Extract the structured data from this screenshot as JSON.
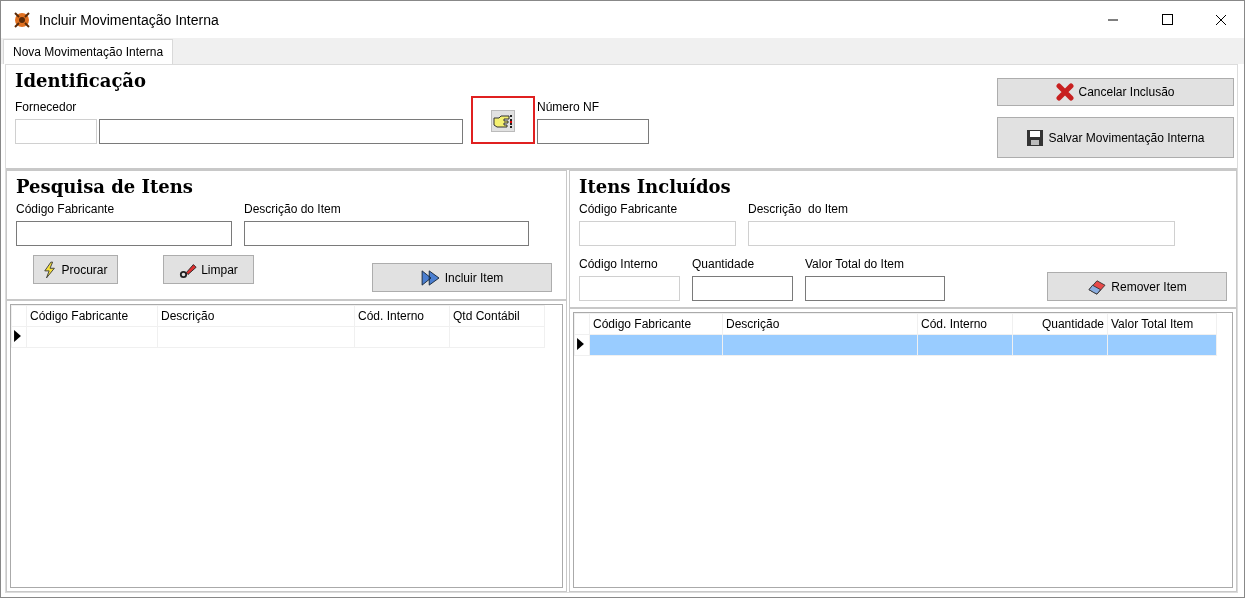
{
  "window": {
    "title": "Incluir Movimentação Interna"
  },
  "tabs": [
    {
      "label": "Nova Movimentação Interna",
      "selected": true
    }
  ],
  "identification": {
    "heading": "Identificação",
    "supplier_label": "Fornecedor",
    "supplier_code_disabled": true,
    "invoice_label": "Número NF",
    "lookup_highlighted": true,
    "buttons": [
      {
        "label": "Cancelar Inclusão",
        "kind": "cancel"
      },
      {
        "label": "Salvar Movimentação Interna",
        "kind": "save"
      }
    ]
  },
  "search": {
    "heading": "Pesquisa de Itens",
    "fields": [
      {
        "label": "Código Fabricante",
        "disabled": false
      },
      {
        "label": "Descrição do Item",
        "disabled": false
      }
    ],
    "buttons": [
      {
        "label": "Procurar",
        "kind": "search"
      },
      {
        "label": "Limpar",
        "kind": "clear"
      },
      {
        "label": "Incluir Item",
        "kind": "add"
      }
    ],
    "table": {
      "columns": [
        "Código Fabricante",
        "Descrição",
        "Cód. Interno",
        "Qtd Contábil"
      ],
      "rows": [
        {
          "selected": false
        }
      ]
    }
  },
  "included": {
    "heading": "Itens Incluídos",
    "fields": [
      {
        "label": "Código Fabricante",
        "disabled": true
      },
      {
        "label": "Descrição  do Item",
        "disabled": true
      },
      {
        "label": "Código Interno",
        "disabled": true
      },
      {
        "label": "Quantidade",
        "disabled": false
      },
      {
        "label": "Valor Total do Item",
        "disabled": false
      }
    ],
    "buttons": [
      {
        "label": "Remover Item",
        "kind": "remove"
      }
    ],
    "table": {
      "columns": [
        "Código Fabricante",
        "Descrição",
        "Cód. Interno",
        "Quantidade",
        "Valor Total Item"
      ],
      "rows": [
        {
          "selected": true
        }
      ]
    }
  }
}
